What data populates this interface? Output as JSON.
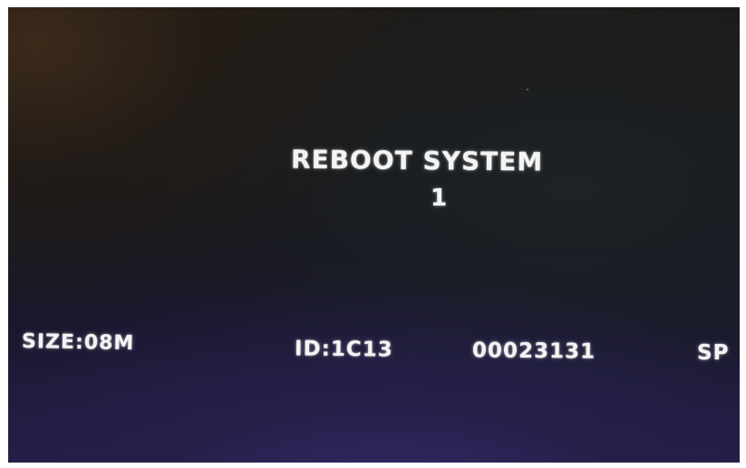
{
  "screen": {
    "title": "REBOOT SYSTEM",
    "reboot_count": "1",
    "size": "SIZE:08M",
    "id": "ID:1C13",
    "serial": "00023131",
    "truncated_label": "SP"
  },
  "colors": {
    "text": "#f4f4f4",
    "background_top": "#1e1b17",
    "background_bottom": "#231e46",
    "frame": "#ffffff"
  }
}
